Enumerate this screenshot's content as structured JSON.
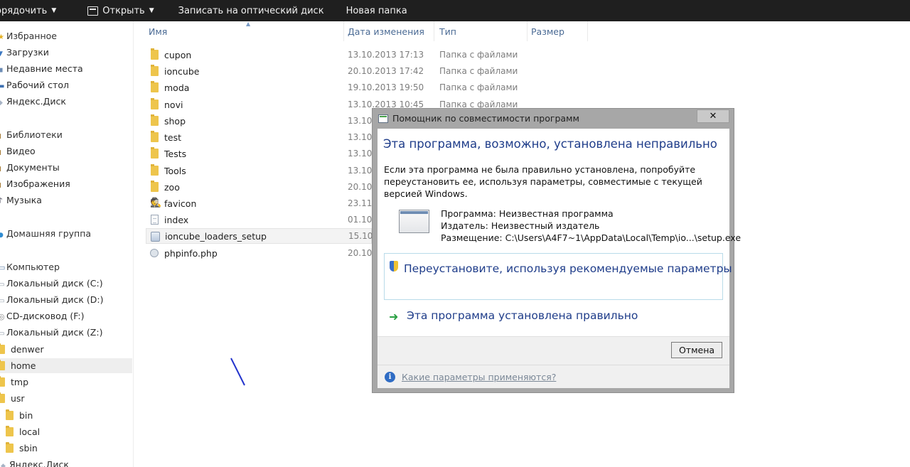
{
  "toolbar": {
    "organize": "орядочить",
    "open": "Открыть",
    "burn": "Записать на оптический диск",
    "new_folder": "Новая папка"
  },
  "nav": {
    "favorites": "Избранное",
    "downloads": "Загрузки",
    "recent": "Недавние места",
    "desktop": "Рабочий стол",
    "yadisk": "Яндекс.Диск",
    "libraries": "Библиотеки",
    "video": "Видео",
    "documents": "Документы",
    "pictures": "Изображения",
    "music": "Музыка",
    "homegroup": "Домашняя группа",
    "computer": "Компьютер",
    "disk_c": "Локальный диск (C:)",
    "disk_d": "Локальный диск (D:)",
    "cd_f": "CD-дисковод (F:)",
    "disk_z": "Локальный диск (Z:)",
    "denwer": "denwer",
    "home": "home",
    "tmp": "tmp",
    "usr": "usr",
    "bin": "bin",
    "local": "local",
    "sbin": "sbin",
    "yadisk2": "Яндекс.Диск"
  },
  "columns": {
    "name": "Имя",
    "date": "Дата изменения",
    "type": "Тип",
    "size": "Размер"
  },
  "files": [
    {
      "name": "cupon",
      "date": "13.10.2013 17:13",
      "type": "Папка с файлами"
    },
    {
      "name": "ioncube",
      "date": "20.10.2013 17:42",
      "type": "Папка с файлами"
    },
    {
      "name": "moda",
      "date": "19.10.2013 19:50",
      "type": "Папка с файлами"
    },
    {
      "name": "novi",
      "date": "13.10.2013 10:45",
      "type": "Папка с файлами"
    },
    {
      "name": "shop",
      "date": "13.10.",
      "type": ""
    },
    {
      "name": "test",
      "date": "13.10.",
      "type": ""
    },
    {
      "name": "Tests",
      "date": "13.10.",
      "type": ""
    },
    {
      "name": "Tools",
      "date": "13.10.",
      "type": ""
    },
    {
      "name": "zoo",
      "date": "20.10.",
      "type": ""
    },
    {
      "name": "favicon",
      "date": "23.11.",
      "type": ""
    },
    {
      "name": "index",
      "date": "01.10.",
      "type": ""
    },
    {
      "name": "ioncube_loaders_setup",
      "date": "15.10.",
      "type": ""
    },
    {
      "name": "phpinfo.php",
      "date": "20.10.",
      "type": ""
    }
  ],
  "dialog": {
    "title": "Помощник по совместимости программ",
    "close_glyph": "✕",
    "heading": "Эта программа, возможно, установлена неправильно",
    "description": "Если эта программа не была правильно установлена, попробуйте переустановить ее, используя параметры, совместимые с текущей версией Windows.",
    "program_line": "Программа: Неизвестная программа",
    "publisher_line": "Издатель: Неизвестный издатель",
    "location_line": "Размещение: C:\\Users\\A4F7~1\\AppData\\Local\\Temp\\io...\\setup.exe",
    "option_reinstall": "Переустановите, используя рекомендуемые параметры",
    "option_ok": "Эта программа установлена правильно",
    "cancel": "Отмена",
    "info_link": "Какие параметры применяются?",
    "info_glyph": "i",
    "arrow_glyph": "➜"
  },
  "colors": {
    "toolbar_bg": "#1f1f1f",
    "link_blue": "#1f3d8a",
    "header_blue": "#4a6a94",
    "folder_yellow": "#eec54c"
  }
}
